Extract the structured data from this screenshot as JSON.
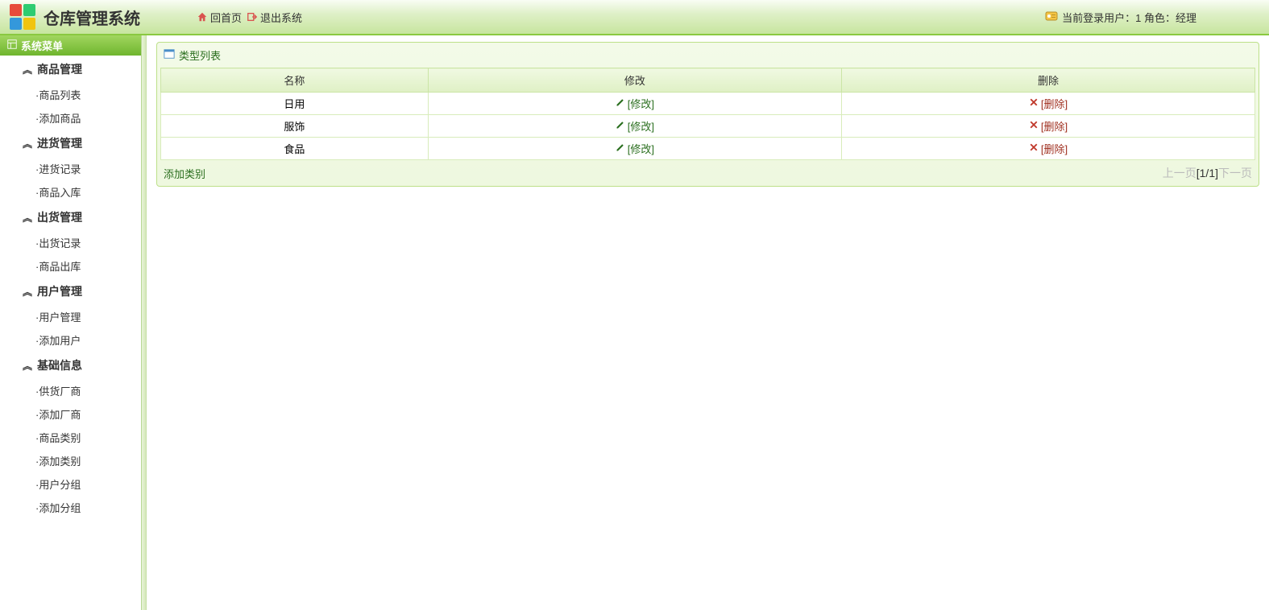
{
  "header": {
    "app_title": "仓库管理系统",
    "home_label": "回首页",
    "exit_label": "退出系统",
    "user_info": "当前登录用户：1 角色：经理"
  },
  "sidebar": {
    "title": "系统菜单",
    "groups": [
      {
        "title": "商品管理",
        "items": [
          "·商品列表",
          "·添加商品"
        ]
      },
      {
        "title": "进货管理",
        "items": [
          "·进货记录",
          "·商品入库"
        ]
      },
      {
        "title": "出货管理",
        "items": [
          "·出货记录",
          "·商品出库"
        ]
      },
      {
        "title": "用户管理",
        "items": [
          "·用户管理",
          "·添加用户"
        ]
      },
      {
        "title": "基础信息",
        "items": [
          "·供货厂商",
          "·添加厂商",
          "·商品类别",
          "·添加类别",
          "·用户分组",
          "·添加分组"
        ]
      }
    ]
  },
  "main": {
    "panel_title": "类型列表",
    "columns": [
      "名称",
      "修改",
      "删除"
    ],
    "edit_label": "[修改]",
    "delete_label": "[删除]",
    "rows": [
      {
        "name": "日用"
      },
      {
        "name": "服饰"
      },
      {
        "name": "食品"
      }
    ],
    "add_link": "添加类别",
    "pager": {
      "prev": "上一页",
      "status": "[1/1]",
      "next": "下一页"
    }
  }
}
